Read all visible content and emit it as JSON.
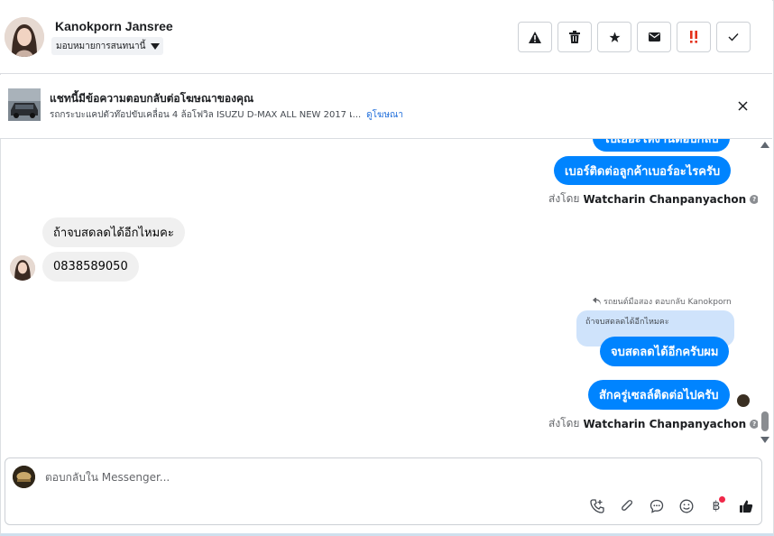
{
  "header": {
    "contact_name": "Kanokporn Jansree",
    "assign_label": "มอบหมายการสนทนานี้",
    "actions": [
      {
        "name": "report-spam-button",
        "icon": "warning-icon"
      },
      {
        "name": "delete-button",
        "icon": "trash-icon"
      },
      {
        "name": "star-button",
        "icon": "star-icon"
      },
      {
        "name": "mark-unread-button",
        "icon": "envelope-icon"
      },
      {
        "name": "follow-up-button",
        "icon": "double-exclamation-icon"
      },
      {
        "name": "mark-done-button",
        "icon": "checkmark-icon"
      }
    ]
  },
  "banner": {
    "title": "แชทนี้มีข้อความตอบกลับต่อโฆษณาของคุณ",
    "subtitle": "รถกระบะแคปตัวท๊อปขับเคลื่อน 4 ล้อโฟวิล ISUZU D-MAX ALL NEW 2017 เ...",
    "link": "ดูโฆษณา"
  },
  "messages": {
    "out_1": "ไปเยอะให้งานตอบกลับ",
    "out_2": "เบอร์ติดต่อลูกค้าเบอร์อะไรครับ",
    "sent_by_prefix": "ส่งโดย",
    "sender_1": "Watcharin Chanpanyachon",
    "in_1": "ถ้าจบสดลดได้อีกไหมคะ",
    "in_2": "0838589050",
    "reply_note": "รถยนต์มือสอง ตอบกลับ Kanokporn",
    "quoted": "ถ้าจบสดลดได้อีกไหมคะ",
    "out_3": "จบสดลดได้อีกครับผม",
    "out_4": "สักครู่เซลล์ติดต่อไปครับ",
    "sender_2": "Watcharin Chanpanyachon"
  },
  "composer": {
    "placeholder": "ตอบกลับใน Messenger..."
  },
  "colors": {
    "accent": "#0084ff",
    "incoming": "#f0f0f0",
    "link": "#216fdb",
    "notify_dot": "#f02849"
  }
}
